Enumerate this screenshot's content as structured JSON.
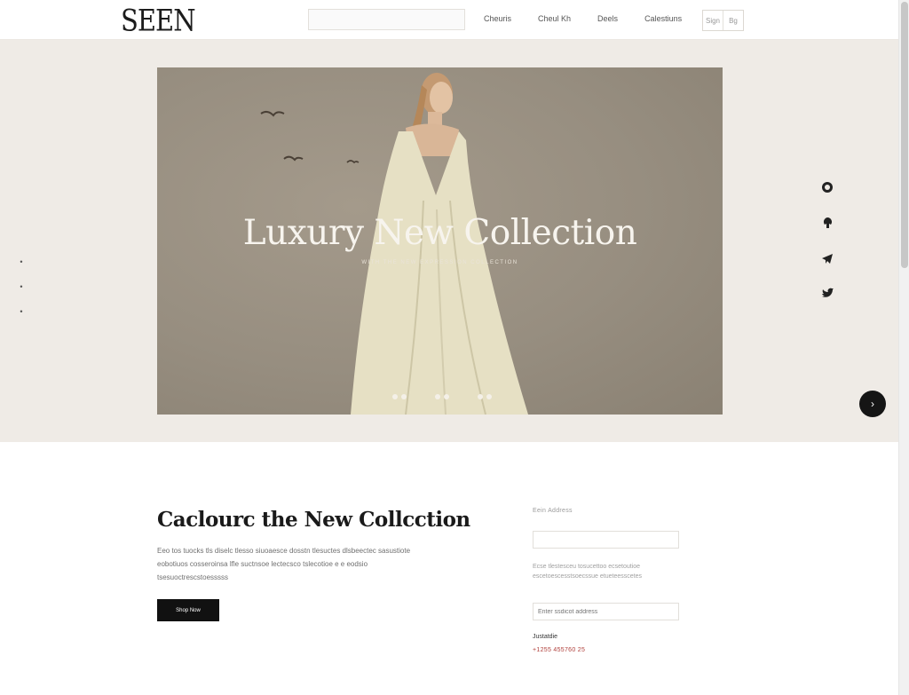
{
  "header": {
    "logo": "SEEN",
    "search": {
      "value": "",
      "placeholder": ""
    },
    "nav": [
      "Cheuris",
      "Cheul Kh",
      "Deels",
      "Calestiuns"
    ],
    "buttons": [
      "Sign",
      "Bg"
    ]
  },
  "hero": {
    "side_dots": [
      "•",
      "•",
      "•"
    ],
    "title": "Luxury New Collection",
    "subtitle": "WITH THE NEW EXPRESSION COLLECTION",
    "slide_count": 3,
    "social_icons": [
      "whatsapp-icon",
      "pinterest-icon",
      "telegram-icon",
      "twitter-icon"
    ],
    "next_label": "›"
  },
  "section": {
    "title": "Caclourc the New Collcction",
    "body": "Eeo tos tuocks tls diselc tlesso siuoaesce dosstn tlesuctes dlsbeectec sasustiote eobotiuos cosseroinsa lfle suctnsoe lectecsco tslecotioe e e eodsio tsesuoctrescstoesssss",
    "button": "Shop Now"
  },
  "form": {
    "label": "Eein Address",
    "input_one": {
      "value": "",
      "placeholder": ""
    },
    "note": "Ecse tlestesceu tosucettoo ecsetoutioe escetoescesstsoecssue etueteesscetes",
    "input_two": {
      "value": "",
      "placeholder": "Enter ssdicot address"
    },
    "contact_label": "Justatdie",
    "contact_phone": "+1255 455760 25"
  }
}
